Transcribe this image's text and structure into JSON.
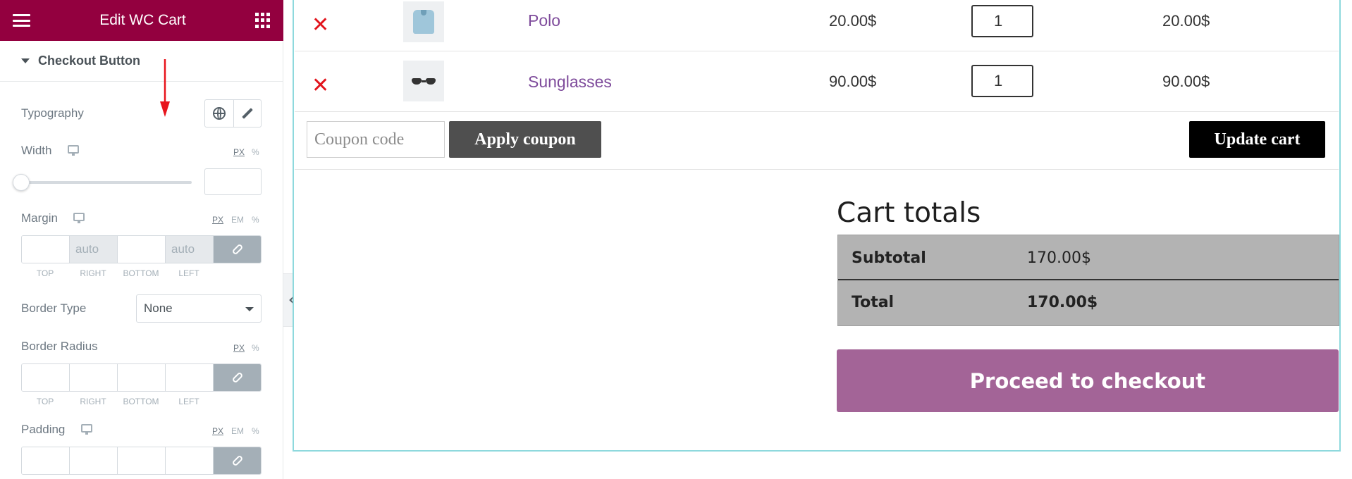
{
  "sidebar": {
    "title": "Edit WC Cart",
    "section_title": "Checkout Button",
    "typography_label": "Typography",
    "width_label": "Width",
    "width_units": [
      "PX",
      "%"
    ],
    "margin_label": "Margin",
    "margin_units": [
      "PX",
      "EM",
      "%"
    ],
    "margin_values": [
      "",
      "auto",
      "",
      "auto"
    ],
    "dim_labels": [
      "TOP",
      "RIGHT",
      "BOTTOM",
      "LEFT"
    ],
    "border_type_label": "Border Type",
    "border_type_value": "None",
    "border_radius_label": "Border Radius",
    "border_radius_units": [
      "PX",
      "%"
    ],
    "padding_label": "Padding",
    "padding_units": [
      "PX",
      "EM",
      "%"
    ],
    "header_color": "#93003f"
  },
  "cart": {
    "items": [
      {
        "name": "Polo",
        "price": "20.00$",
        "qty": "1",
        "subtotal": "20.00$",
        "icon": "polo-shirt-thumbnail"
      },
      {
        "name": "Sunglasses",
        "price": "90.00$",
        "qty": "1",
        "subtotal": "90.00$",
        "icon": "sunglasses-thumbnail"
      }
    ],
    "coupon_placeholder": "Coupon code",
    "apply_coupon_label": "Apply coupon",
    "update_cart_label": "Update cart"
  },
  "totals": {
    "title": "Cart totals",
    "subtotal_label": "Subtotal",
    "subtotal_value": "170.00$",
    "total_label": "Total",
    "total_value": "170.00$",
    "checkout_label": "Proceed to checkout",
    "checkout_color": "#a36497"
  }
}
